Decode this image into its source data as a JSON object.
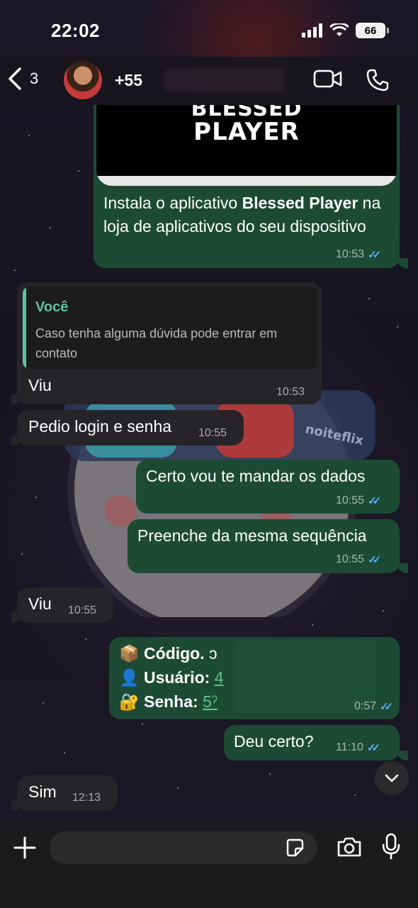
{
  "status_bar": {
    "time": "22:02",
    "battery": "66"
  },
  "header": {
    "back_count": "3",
    "contact": "+55"
  },
  "image_card": {
    "brand_line1": "BLESSED",
    "brand_line2": "PLAYER"
  },
  "messages": [
    {
      "dir": "out",
      "text_pre": "Instala o aplicativo ",
      "text_bold": "Blessed Player",
      "text_post": " na loja de aplicativos do seu dispositivo",
      "time": "10:53"
    },
    {
      "dir": "in",
      "quote_author": "Você",
      "quote_text": "Caso tenha alguma dúvida pode entrar em contato",
      "text": "Viu",
      "time": "10:53"
    },
    {
      "dir": "in",
      "text": "Pedio login e senha",
      "time": "10:55"
    },
    {
      "dir": "out",
      "text": "Certo vou te mandar os dados",
      "time": "10:55"
    },
    {
      "dir": "out",
      "text": "Preenche da mesma sequência",
      "time": "10:55"
    },
    {
      "dir": "in",
      "text": "Viu",
      "time": "10:55"
    },
    {
      "dir": "out",
      "lines": [
        {
          "emoji": "📦",
          "label": "Código.",
          "value": "ɔ"
        },
        {
          "emoji": "👤",
          "label": "Usuário:",
          "value": "4"
        },
        {
          "emoji": "🔐",
          "label": "Senha:",
          "value": "5ˀ"
        }
      ],
      "time": "0:57"
    },
    {
      "dir": "out",
      "text": "Deu certo?",
      "time": "11:10"
    },
    {
      "dir": "in",
      "text": "Sim",
      "time": "12:13"
    }
  ],
  "wallpaper_text": "noiteflix",
  "composer": {
    "placeholder": ""
  },
  "colors": {
    "outgoing": "#1d4a35",
    "incoming": "#262428",
    "accent": "#5dc4a4",
    "read_ticks": "#56b0f2"
  }
}
